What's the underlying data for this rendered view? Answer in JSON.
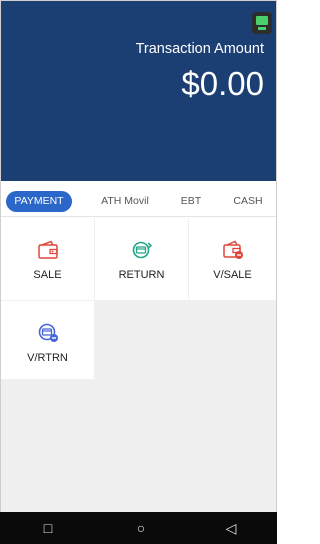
{
  "header": {
    "amount_label": "Transaction Amount",
    "amount_value": "$0.00",
    "background": "#1b3e73"
  },
  "tabs": [
    {
      "label": "PAYMENT",
      "active": true
    },
    {
      "label": "ATH Movil",
      "active": false
    },
    {
      "label": "EBT",
      "active": false
    },
    {
      "label": "CASH",
      "active": false
    }
  ],
  "actions": [
    {
      "label": "SALE",
      "icon": "wallet-icon",
      "color": "#e0463c"
    },
    {
      "label": "RETURN",
      "icon": "return-card-icon",
      "color": "#1ea686"
    },
    {
      "label": "V/SALE",
      "icon": "void-wallet-icon",
      "color": "#e0463c"
    },
    {
      "label": "V/RTRN",
      "icon": "void-return-icon",
      "color": "#4466d8"
    }
  ],
  "nav": {
    "back_icon": "□",
    "home_icon": "○",
    "recent_icon": "◁"
  },
  "colors": {
    "accent": "#2a67c8",
    "status_icon": "#4ad06a"
  }
}
